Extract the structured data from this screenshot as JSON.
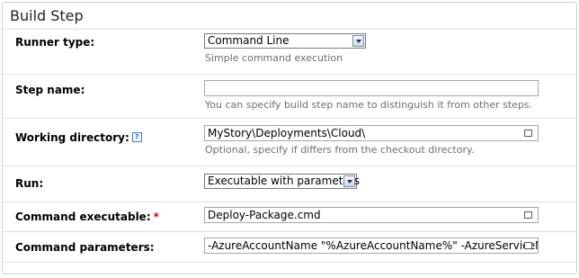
{
  "section_title": "Build Step",
  "runner_type": {
    "label": "Runner type:",
    "value": "Command Line",
    "hint": "Simple command execution"
  },
  "step_name": {
    "label": "Step name:",
    "value": "",
    "hint": "You can specify build step name to distinguish it from other steps."
  },
  "working_directory": {
    "label": "Working directory:",
    "help_icon": "?",
    "value": "MyStory\\Deployments\\Cloud\\",
    "hint": "Optional, specify if differs from the checkout directory."
  },
  "run": {
    "label": "Run:",
    "value": "Executable with parameters"
  },
  "command_executable": {
    "label": "Command executable:",
    "required_mark": "*",
    "value": "Deploy-Package.cmd"
  },
  "command_parameters": {
    "label": "Command parameters:",
    "value": "-AzureAccountName \"%AzureAccountName%\" -AzureServiceN"
  }
}
